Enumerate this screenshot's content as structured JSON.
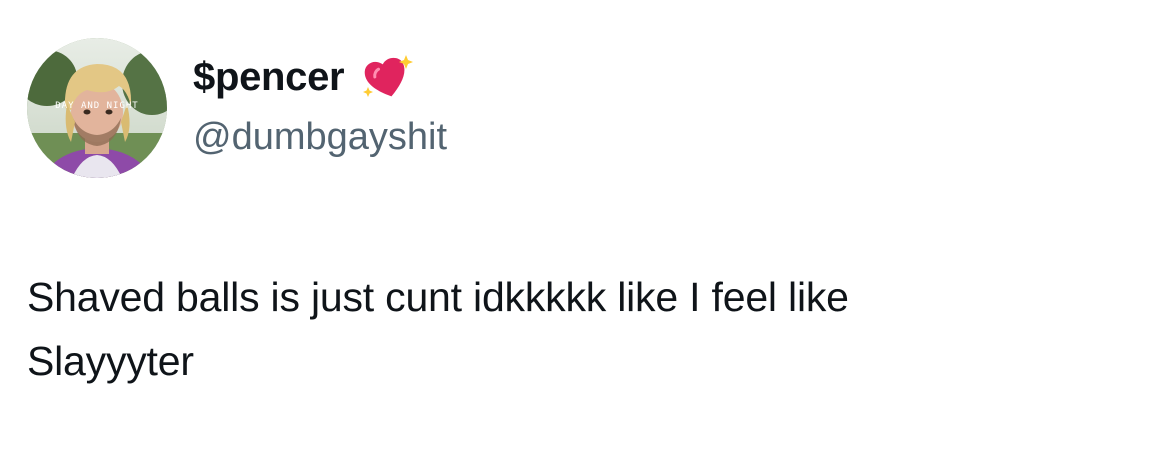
{
  "author": {
    "display_name": "$pencer",
    "handle": "@dumbgayshit",
    "name_emoji": "sparkling-heart-icon",
    "avatar_overlay_text": "DAY AND NIGHT"
  },
  "tweet": {
    "text_line_1": "Shaved balls is just cunt idkkkkk like I feel like",
    "text_line_2": "Slayyyter"
  },
  "colors": {
    "text_primary": "#0f1419",
    "text_secondary": "#536471",
    "heart": "#e0245e",
    "background": "#ffffff"
  }
}
